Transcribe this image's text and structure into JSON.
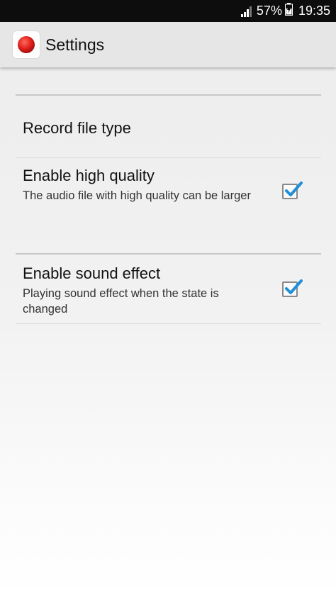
{
  "status_bar": {
    "battery_percent": "57%",
    "time": "19:35",
    "icons": [
      "signal-icon",
      "battery-icon"
    ]
  },
  "app_bar": {
    "title": "Settings",
    "icon": "record-app-icon"
  },
  "preferences": [
    {
      "title": "Record file type"
    },
    {
      "title": "Enable high quality",
      "summary": "The audio file with high quality can be larger",
      "checked": true
    },
    {
      "title": "Enable sound effect",
      "summary": "Playing sound effect when the state is changed",
      "checked": true
    }
  ],
  "colors": {
    "status_bar_bg": "#0d0d0d",
    "app_bar_bg": "#e6e6e6",
    "record_red": "#e0201c",
    "check_blue": "#1e8fd8"
  }
}
